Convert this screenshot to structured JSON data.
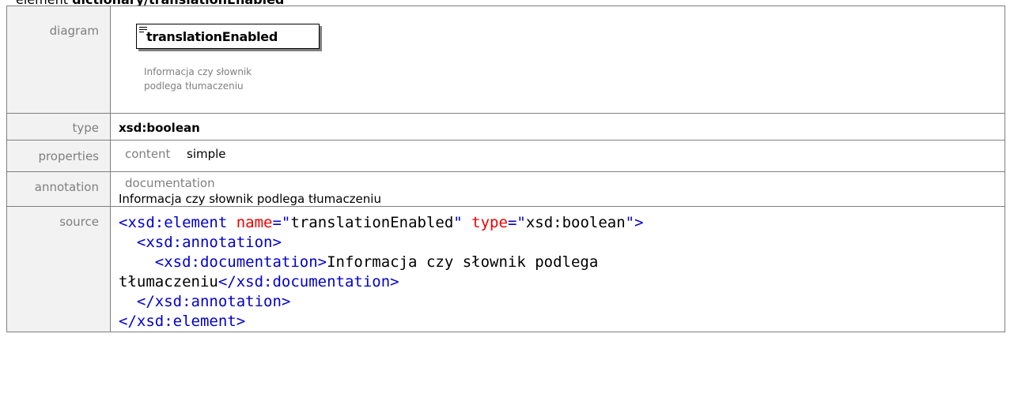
{
  "heading": {
    "prefix": "element ",
    "name": "dictionary/translationEnabled"
  },
  "labels": {
    "diagram": "diagram",
    "type": "type",
    "properties": "properties",
    "annotation": "annotation",
    "source": "source"
  },
  "diagram": {
    "element_name": "translationEnabled",
    "doc_line1": "Informacja czy słownik",
    "doc_line2": "podlega tłumaczeniu"
  },
  "type": {
    "value": "xsd:boolean"
  },
  "properties": {
    "key": "content",
    "value": "simple"
  },
  "annotation": {
    "key": "documentation",
    "value": "Informacja czy słownik podlega tłumaczeniu"
  },
  "source": {
    "l1_open": "<xsd:element ",
    "l1_attr1": "name",
    "l1_eq1": "=\"",
    "l1_val1": "translationEnabled",
    "l1_q1": "\" ",
    "l1_attr2": "type",
    "l1_eq2": "=\"",
    "l1_val2": "xsd:boolean",
    "l1_close": "\">",
    "l2": "<xsd:annotation>",
    "l3_open": "<xsd:documentation>",
    "l3_text": "Informacja czy słownik podlega",
    "l4_text": "tłumaczeniu",
    "l4_close": "</xsd:documentation>",
    "l5": "</xsd:annotation>",
    "l6": "</xsd:element>"
  }
}
